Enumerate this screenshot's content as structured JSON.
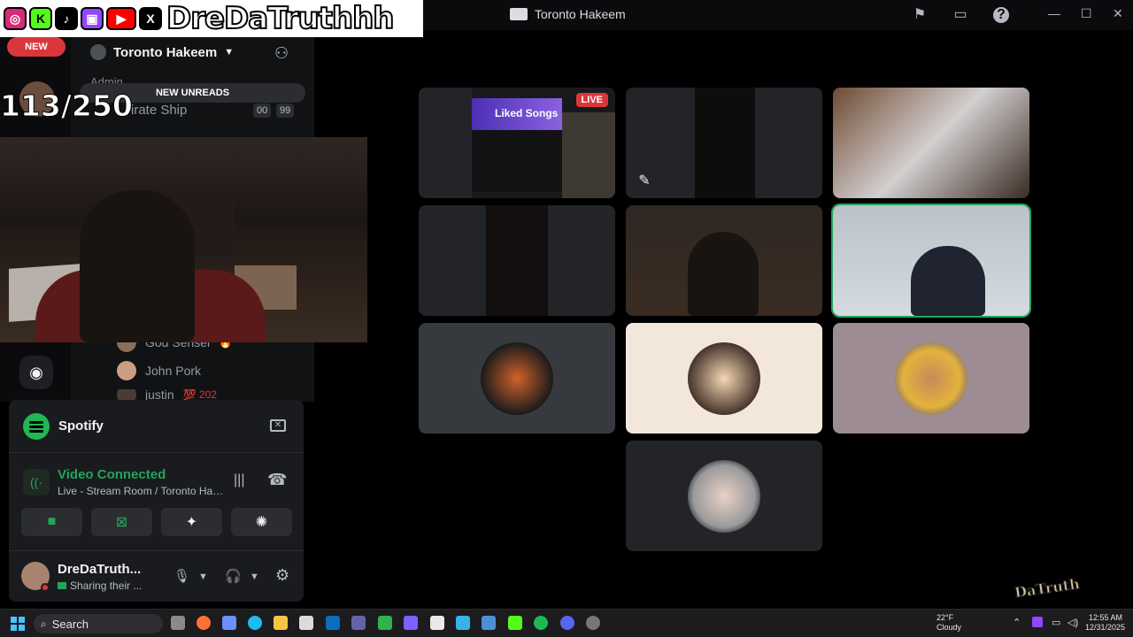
{
  "window": {
    "title": "Toronto Hakeem"
  },
  "overlay": {
    "handle": "DreDaTruthhh",
    "counter": "113/250",
    "socials": [
      {
        "icon": "instagram-icon",
        "color": "#d62976",
        "glyph": "◎"
      },
      {
        "icon": "kick-icon",
        "color": "#53fc18",
        "glyph": "K"
      },
      {
        "icon": "tiktok-icon",
        "color": "#000000",
        "glyph": "♪"
      },
      {
        "icon": "twitch-icon",
        "color": "#9146ff",
        "glyph": "▣"
      },
      {
        "icon": "youtube-icon",
        "color": "#ff0000",
        "glyph": "▶"
      },
      {
        "icon": "x-icon",
        "color": "#000000",
        "glyph": "X"
      }
    ]
  },
  "servers": {
    "new_label": "NEW"
  },
  "sidebar": {
    "server_name": "Toronto Hakeem",
    "admin_label": "Admin",
    "new_unreads": "NEW UNREADS",
    "channel": "irate Ship",
    "badges": [
      "00",
      "99"
    ],
    "members": [
      {
        "name": "God Sensei",
        "emoji": "🔥"
      },
      {
        "name": "John Pork",
        "emoji": ""
      },
      {
        "name": "justin",
        "emoji": "💯 202"
      }
    ]
  },
  "spotify": {
    "label": "Spotify"
  },
  "voice": {
    "status": "Video Connected",
    "location": "Live - Stream Room / Toronto Hakeem"
  },
  "user": {
    "name": "DreDaTruth...",
    "status": "Sharing their ..."
  },
  "stream": {
    "live_label": "LIVE",
    "playlist": "Liked Songs"
  },
  "taskbar": {
    "search_placeholder": "Search",
    "weather_temp": "22°F",
    "weather_desc": "Cloudy",
    "time": "12:55 AM",
    "date": "12/31/2025"
  },
  "watermark": "DaTruth",
  "colors": {
    "accent_green": "#23a559",
    "danger_red": "#da373c",
    "spotify_green": "#1db954"
  }
}
